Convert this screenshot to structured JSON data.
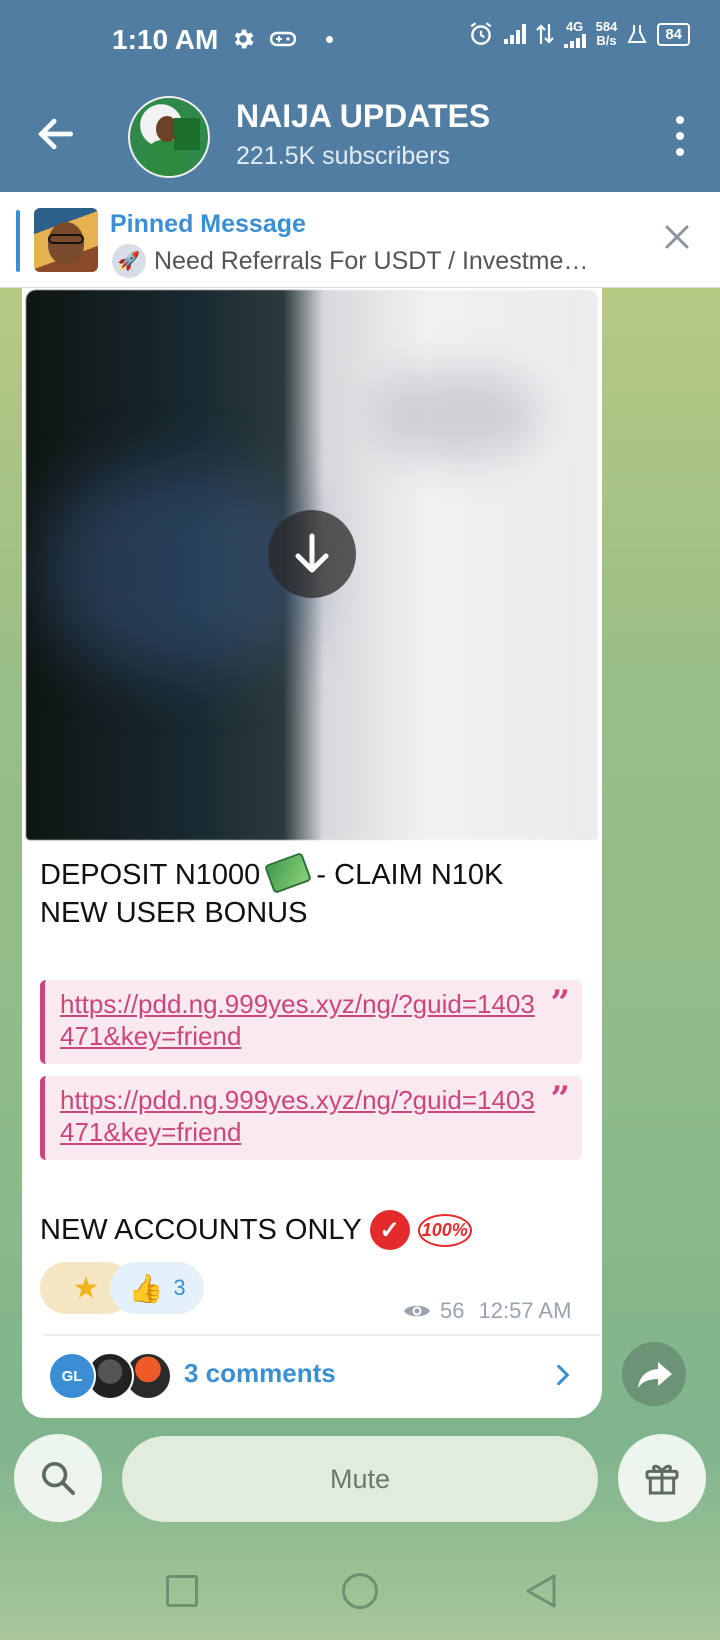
{
  "status": {
    "time": "1:10 AM",
    "network": "4G",
    "speed_value": "584",
    "speed_unit": "B/s",
    "battery": "84"
  },
  "header": {
    "title": "NAIJA UPDATES",
    "subtitle": "221.5K subscribers"
  },
  "pinned": {
    "title": "Pinned Message",
    "text": "Need Referrals For USDT / Investme…"
  },
  "post": {
    "line1": "DEPOSIT N1000",
    "line1_suffix": " - CLAIM N10K",
    "line2": "NEW USER BONUS",
    "links": [
      "https://pdd.ng.999yes.xyz/ng/?guid=1403471&key=friend",
      "https://pdd.ng.999yes.xyz/ng/?guid=1403471&key=friend"
    ],
    "line3": "NEW ACCOUNTS ONLY",
    "badge_text": "100%",
    "reactions": {
      "star_count": "",
      "thumbs_count": "3"
    },
    "views": "56",
    "time": "12:57 AM",
    "comments": "3 comments",
    "commenter_initials": "GL"
  },
  "bottom": {
    "mute_label": "Mute"
  },
  "colors": {
    "header_bg": "#517da2",
    "accent": "#3a8fd4",
    "link": "#c9477d"
  }
}
